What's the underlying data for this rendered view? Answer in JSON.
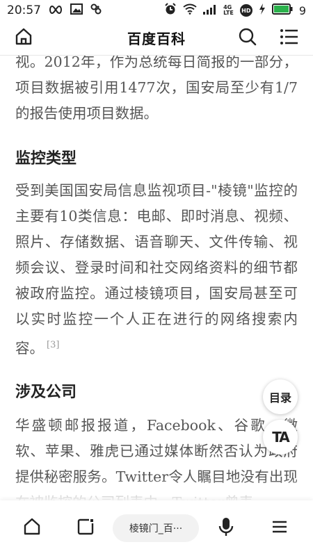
{
  "status": {
    "time": "20:57",
    "net_badge_top": "4G",
    "net_badge_bottom": "LTE",
    "hd_label": "HD",
    "battery_level": "9"
  },
  "header": {
    "title": "百度百科"
  },
  "article": {
    "para1": "视。2012年，作为总统每日简报的一部分，项目数据被引用1477次，国安局至少有1/7的报告使用项目数据。",
    "heading1": "监控类型",
    "para2": "受到美国国安局信息监视项目-\"棱镜\"监控的主要有10类信息：电邮、即时消息、视频、照片、存储数据、语音聊天、文件传输、视频会议、登录时间和社交网络资料的细节都被政府监控。通过棱镜项目，国安局甚至可以实时监控一个人正在进行的网络搜索内容。",
    "para2_ref": "[3]",
    "heading2": "涉及公司",
    "para3": "华盛顿邮报报道，Facebook、谷歌、微软、苹果、雅虎已通过媒体断然否认为政府提供秘密服务。Twitter令人瞩目地没有出现在被监控的公司列表中，Twitter曾表"
  },
  "fab": {
    "toc_label": "目录",
    "ta_label": "TA"
  },
  "bottom": {
    "tab_title": "棱镜门_百···"
  },
  "colors": {
    "text": "#555555",
    "heading": "#222222",
    "battery": "#2bb24c"
  }
}
